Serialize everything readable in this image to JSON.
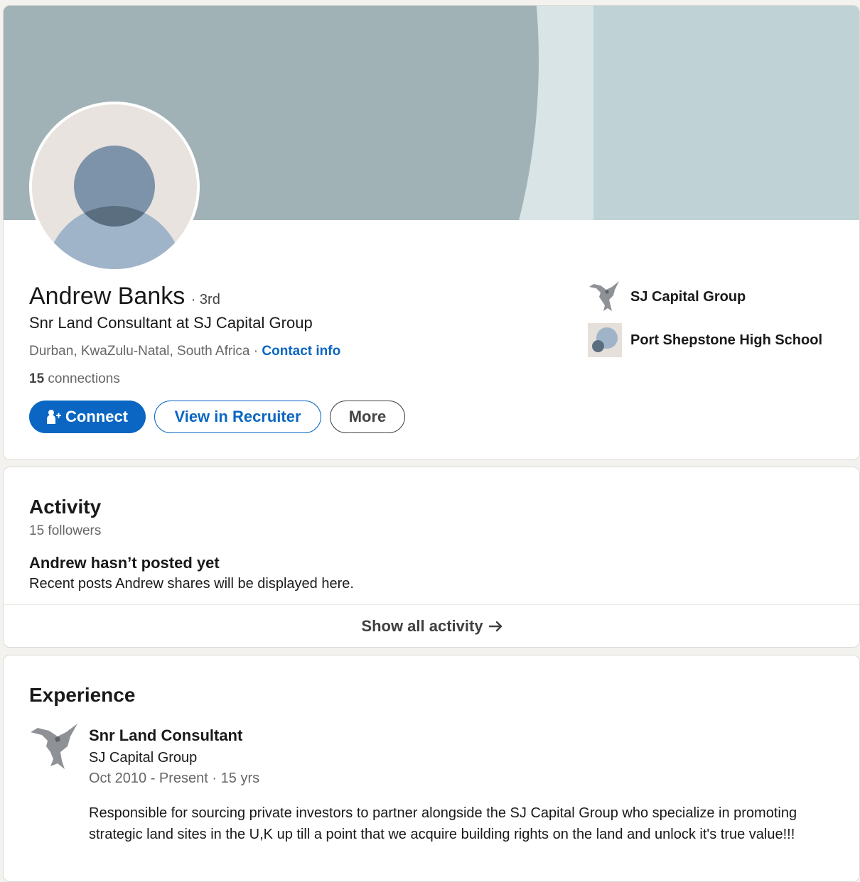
{
  "profile": {
    "name": "Andrew Banks",
    "degree": "· 3rd",
    "headline": "Snr Land Consultant at SJ Capital Group",
    "location": "Durban, KwaZulu-Natal, South Africa",
    "separator": " · ",
    "contact_label": "Contact info",
    "connections_count": "15",
    "connections_label": " connections",
    "buttons": {
      "connect": "Connect",
      "recruiter": "View in Recruiter",
      "more": "More"
    },
    "affiliations": [
      {
        "label": "SJ Capital Group",
        "icon": "eagle-logo-icon"
      },
      {
        "label": "Port Shepstone High School",
        "icon": "school-logo-icon"
      }
    ]
  },
  "activity": {
    "title": "Activity",
    "followers": "15 followers",
    "empty_title": "Andrew hasn’t posted yet",
    "empty_subtitle": "Recent posts Andrew shares will be displayed here.",
    "show_all": "Show all activity"
  },
  "experience": {
    "title": "Experience",
    "items": [
      {
        "role": "Snr Land Consultant",
        "company": "SJ Capital Group",
        "dates": "Oct 2010 - Present · 15 yrs",
        "description": "Responsible for sourcing private investors to partner alongside the SJ Capital Group who specialize in promoting strategic land sites in the U,K up till a point that we acquire building rights on the land and unlock it's true value!!!"
      }
    ]
  },
  "colors": {
    "brand_blue": "#0a66c2",
    "banner_dark": "#a0b2b5",
    "banner_light": "#bfd2d6",
    "page_bg": "#f4f2ee"
  }
}
